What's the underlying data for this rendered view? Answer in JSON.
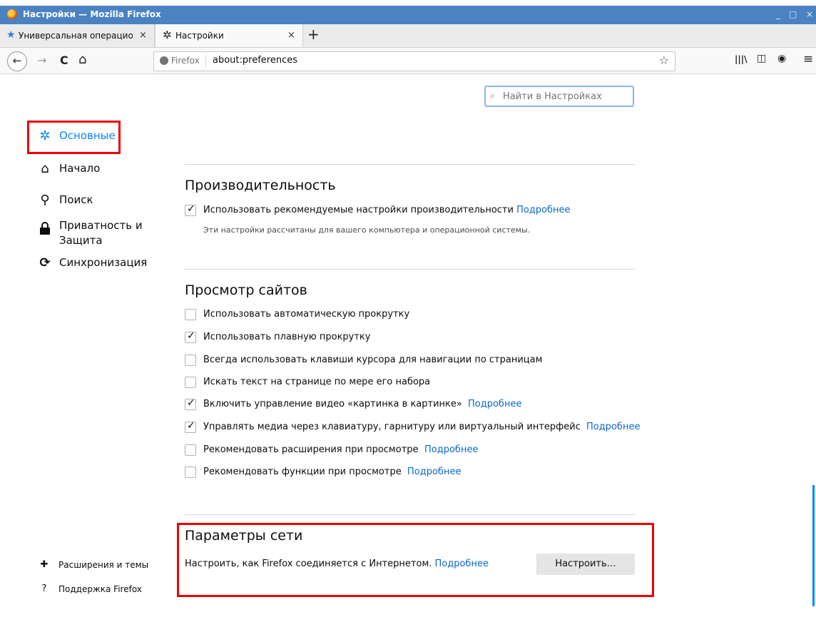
{
  "window": {
    "title": "Настройки — Mozilla Firefox",
    "min": "_",
    "max": "□",
    "close": "×"
  },
  "tabs": [
    {
      "label": "Универсальная операцио",
      "close": "×"
    },
    {
      "label": "Настройки",
      "close": "×"
    }
  ],
  "new_tab": "+",
  "nav": {
    "back": "←",
    "forward": "→",
    "reload": "C",
    "home": "⌂",
    "site_label": "Firefox",
    "url": "about:preferences",
    "bookmark": "☆",
    "library": "|||\\",
    "sidebar": "◫",
    "account": "◉",
    "menu": "≡"
  },
  "search": {
    "placeholder": "Найти в Настройках"
  },
  "sidebar": {
    "items": [
      {
        "label": "Основные",
        "icon": "gear-icon"
      },
      {
        "label": "Начало",
        "icon": "home-icon"
      },
      {
        "label": "Поиск",
        "icon": "search-icon"
      },
      {
        "label": "Приватность и Защита",
        "icon": "lock-icon"
      },
      {
        "label": "Синхронизация",
        "icon": "sync-icon"
      }
    ],
    "footer": [
      {
        "label": "Расширения и темы",
        "icon": "puzzle-icon"
      },
      {
        "label": "Поддержка Firefox",
        "icon": "help-icon"
      }
    ]
  },
  "performance": {
    "heading": "Производительность",
    "use_recommended": "Использовать рекомендуемые настройки производительности",
    "link": "Подробнее",
    "description": "Эти настройки рассчитаны для вашего компьютера и операционной системы."
  },
  "browsing": {
    "heading": "Просмотр сайтов",
    "options": [
      {
        "label": "Использовать автоматическую прокрутку",
        "checked": false,
        "link": ""
      },
      {
        "label": "Использовать плавную прокрутку",
        "checked": true,
        "link": ""
      },
      {
        "label": "Всегда использовать клавиши курсора для навигации по страницам",
        "checked": false,
        "link": ""
      },
      {
        "label": "Искать текст на странице по мере его набора",
        "checked": false,
        "link": ""
      },
      {
        "label": "Включить управление видео «картинка в картинке»",
        "checked": true,
        "link": "Подробнее"
      },
      {
        "label": "Управлять медиа через клавиатуру, гарнитуру или виртуальный интерфейс",
        "checked": true,
        "link": "Подробнее"
      },
      {
        "label": "Рекомендовать расширения при просмотре",
        "checked": false,
        "link": "Подробнее"
      },
      {
        "label": "Рекомендовать функции при просмотре",
        "checked": false,
        "link": "Подробнее"
      }
    ]
  },
  "network": {
    "heading": "Параметры сети",
    "text": "Настроить, как Firefox соединяется с Интернетом.",
    "link": "Подробнее",
    "button": "Настроить…"
  },
  "colors": {
    "accent": "#0a84ff",
    "link": "#0a67c6",
    "highlight": "#ef0000",
    "titlebar": "#4a82c2"
  }
}
